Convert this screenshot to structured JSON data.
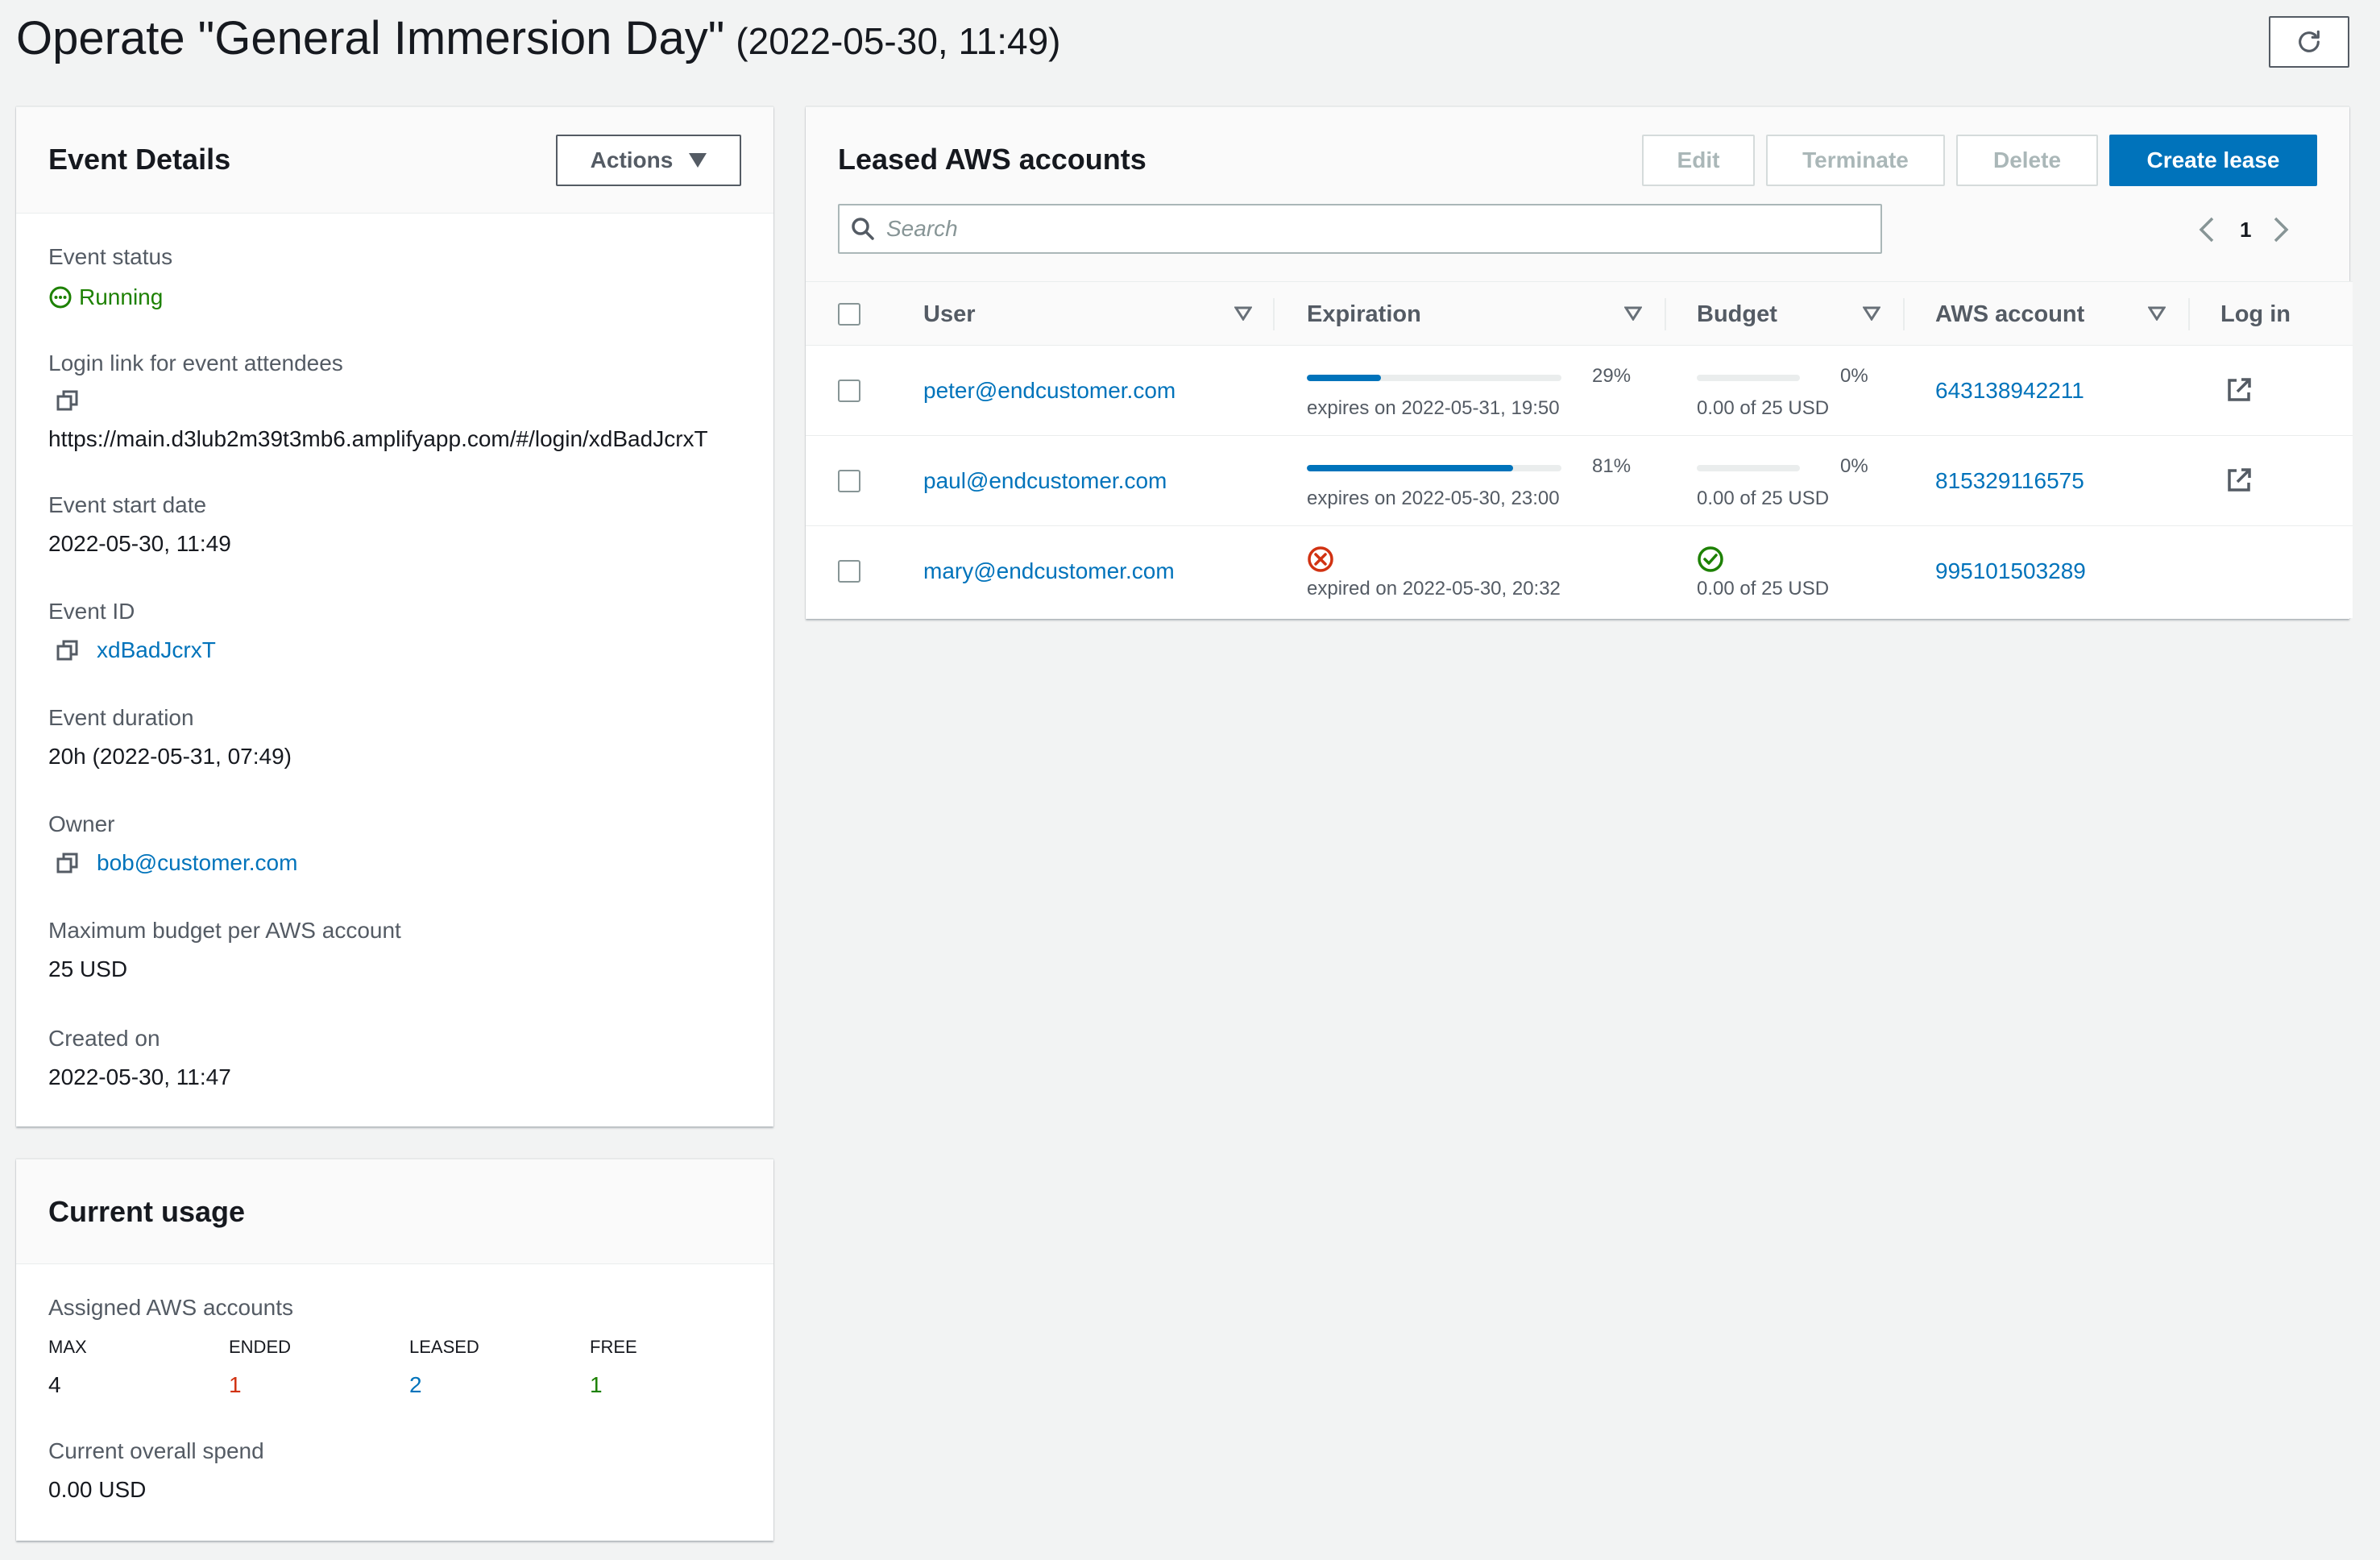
{
  "header": {
    "title": "Operate \"General Immersion Day\"",
    "subtitle": "(2022-05-30, 11:49)"
  },
  "event_details": {
    "title": "Event Details",
    "actions_label": "Actions",
    "fields": {
      "status_label": "Event status",
      "status_value": "Running",
      "login_link_label": "Login link for event attendees",
      "login_link_value": "https://main.d3lub2m39t3mb6.amplifyapp.com/#/login/xdBadJcrxT",
      "start_date_label": "Event start date",
      "start_date_value": "2022-05-30, 11:49",
      "event_id_label": "Event ID",
      "event_id_value": "xdBadJcrxT",
      "duration_label": "Event duration",
      "duration_value": "20h (2022-05-31, 07:49)",
      "owner_label": "Owner",
      "owner_value": "bob@customer.com",
      "max_budget_label": "Maximum budget per AWS account",
      "max_budget_value": "25 USD",
      "created_label": "Created on",
      "created_value": "2022-05-30, 11:47"
    }
  },
  "current_usage": {
    "title": "Current usage",
    "assigned_label": "Assigned AWS accounts",
    "columns": [
      {
        "label": "MAX",
        "value": "4",
        "color": "#16191f"
      },
      {
        "label": "ENDED",
        "value": "1",
        "color": "#d13212"
      },
      {
        "label": "LEASED",
        "value": "2",
        "color": "#0073bb"
      },
      {
        "label": "FREE",
        "value": "1",
        "color": "#1d8102"
      }
    ],
    "spend_label": "Current overall spend",
    "spend_value": "0.00 USD"
  },
  "leases": {
    "title": "Leased AWS accounts",
    "buttons": {
      "edit": "Edit",
      "terminate": "Terminate",
      "delete": "Delete",
      "create": "Create lease"
    },
    "search_placeholder": "Search",
    "page": "1",
    "columns": {
      "user": "User",
      "expiration": "Expiration",
      "budget": "Budget",
      "account": "AWS account",
      "login": "Log in"
    },
    "rows": [
      {
        "user": "peter@endcustomer.com",
        "expiration_state": "active",
        "expiration_pct": 29,
        "expiration_pct_label": "29%",
        "expiration_text": "expires on 2022-05-31, 19:50",
        "budget_state": "active",
        "budget_pct": 0,
        "budget_pct_label": "0%",
        "budget_text": "0.00 of 25 USD",
        "account": "643138942211",
        "login": true
      },
      {
        "user": "paul@endcustomer.com",
        "expiration_state": "active",
        "expiration_pct": 81,
        "expiration_pct_label": "81%",
        "expiration_text": "expires on 2022-05-30, 23:00",
        "budget_state": "active",
        "budget_pct": 0,
        "budget_pct_label": "0%",
        "budget_text": "0.00 of 25 USD",
        "account": "815329116575",
        "login": true
      },
      {
        "user": "mary@endcustomer.com",
        "expiration_state": "expired",
        "expiration_text": "expired on 2022-05-30, 20:32",
        "budget_state": "ok",
        "budget_text": "0.00 of 25 USD",
        "account": "995101503289",
        "login": false
      }
    ]
  },
  "colors": {
    "link": "#0073bb",
    "primary": "#0073bb",
    "running": "#1d8102",
    "error": "#d13212",
    "success": "#1d8102"
  },
  "icons": {
    "refresh": "refresh-icon",
    "copy": "copy-icon",
    "search": "search-icon",
    "external": "external-link-icon",
    "error": "x-circle-icon",
    "success": "check-circle-icon",
    "status": "in-progress-icon"
  }
}
